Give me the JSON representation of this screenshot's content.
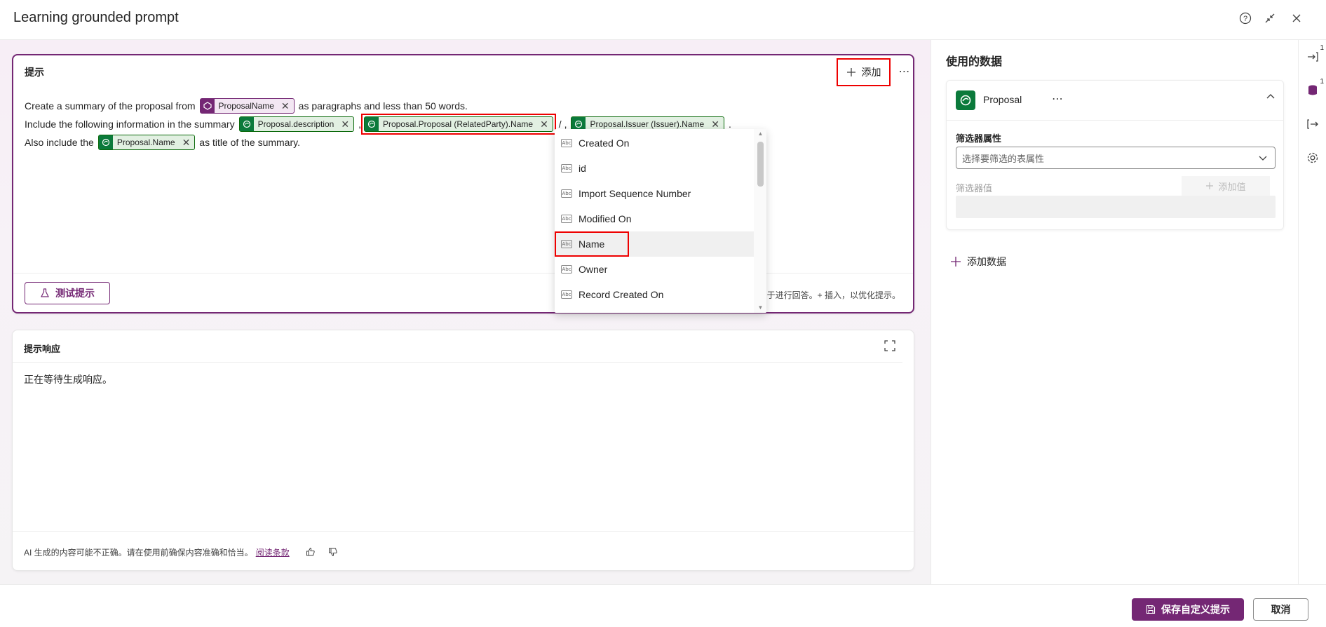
{
  "header": {
    "title": "Learning grounded prompt"
  },
  "prompt": {
    "title": "提示",
    "add_label": "添加",
    "more_label": "⋯",
    "line1": {
      "pre": "Create a summary of the proposal from",
      "chip": "ProposalName",
      "post": "as paragraphs and less than 50 words."
    },
    "line2": {
      "pre": "Include the following information in the summary",
      "chip1": "Proposal.description",
      "sep1": ",",
      "chip2": "Proposal.Proposal (RelatedParty).Name",
      "sep2": "/ ,",
      "chip3": "Proposal.Issuer (Issuer).Name",
      "sep3": "."
    },
    "line3": {
      "pre": "Also include the",
      "chip": "Proposal.Name",
      "post": "as title of the summary."
    },
    "test_label": "测试提示",
    "hint": "于进行回答。+ 插入，以优化提示。"
  },
  "dropdown": {
    "items": [
      "Created On",
      "id",
      "Import Sequence Number",
      "Modified On",
      "Name",
      "Owner",
      "Record Created On"
    ],
    "highlighted": "Name"
  },
  "response": {
    "title": "提示响应",
    "waiting_text": "正在等待生成响应。",
    "disclaimer": "AI 生成的内容可能不正确。请在使用前确保内容准确和恰当。",
    "terms_link": "阅读条款"
  },
  "data_panel": {
    "title": "使用的数据",
    "source_name": "Proposal",
    "filter_attr_label": "筛选器属性",
    "filter_attr_placeholder": "选择要筛选的表属性",
    "filter_value_label": "筛选器值",
    "add_value_label": "添加值",
    "add_data_label": "添加数据"
  },
  "side_rail": {
    "badge1": "1",
    "badge2": "1"
  },
  "footer": {
    "save_label": "保存自定义提示",
    "cancel_label": "取消"
  },
  "colors": {
    "accent": "#742774",
    "dataverse_green": "#0b7a3b",
    "highlight_red": "#e00000"
  }
}
